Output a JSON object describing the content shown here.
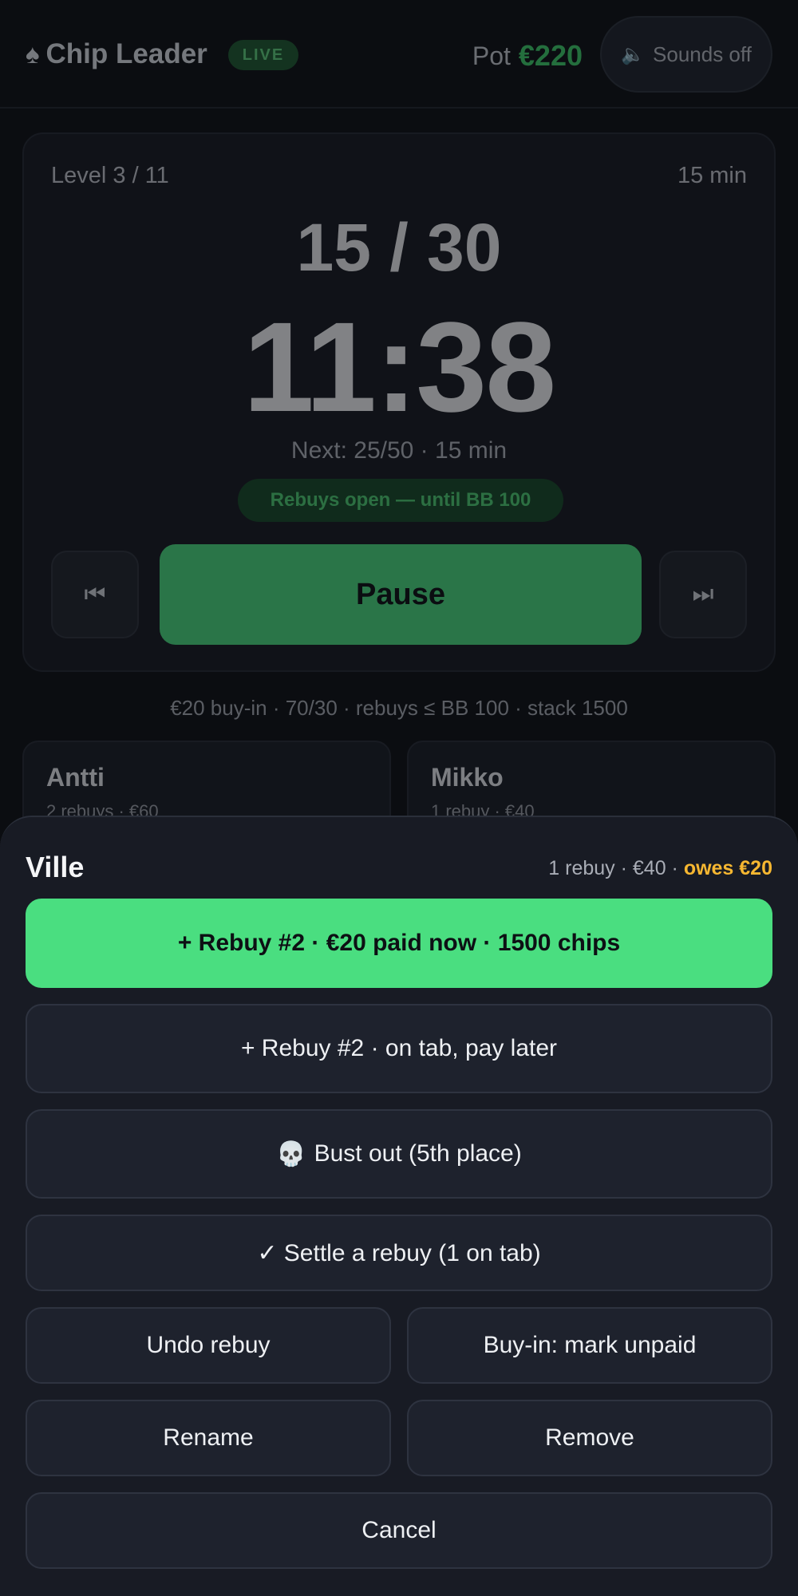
{
  "header": {
    "brand": "Chip Leader",
    "brand_icon": "♠",
    "live_badge": "LIVE",
    "pot_label": "Pot",
    "pot_amount": "€220",
    "sounds_label": "Sounds off",
    "sounds_icon": "🔈"
  },
  "timer": {
    "level": "Level 3 / 11",
    "level_duration": "15 min",
    "blinds": "15 / 30",
    "clock": "11:38",
    "next": "Next: 25/50 · 15 min",
    "rebuy_status": "Rebuys open — until BB 100",
    "prev_icon": "⏮",
    "next_icon": "⏭",
    "pause_label": "Pause"
  },
  "rules_line": "€20 buy-in · 70/30 · rebuys ≤ BB 100 · stack 1500",
  "players": [
    {
      "name": "Antti",
      "sub": "2 rebuys · €60"
    },
    {
      "name": "Mikko",
      "sub": "1 rebuy · €40"
    }
  ],
  "sheet": {
    "player_name": "Ville",
    "meta": "1 rebuy · €40 · ",
    "owes": "owes €20",
    "rebuy_paid": "+ Rebuy #2 · €20 paid now · 1500 chips",
    "rebuy_tab": "+ Rebuy #2 · on tab, pay later",
    "bust_icon": "💀",
    "bust": "Bust out (5th place)",
    "settle": "✓ Settle a rebuy (1 on tab)",
    "undo": "Undo rebuy",
    "unpaid": "Buy-in: mark unpaid",
    "rename": "Rename",
    "remove": "Remove",
    "cancel": "Cancel"
  },
  "colors": {
    "accent_green": "#4ade80",
    "owes_yellow": "#f6b731",
    "background": "#0b0d11",
    "sheet": "#181b24"
  }
}
